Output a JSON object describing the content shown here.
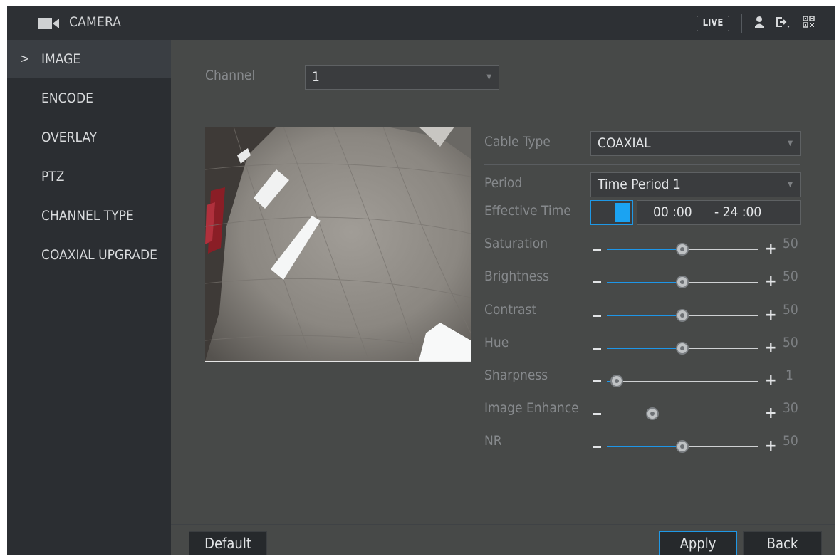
{
  "header": {
    "title": "CAMERA",
    "live_label": "LIVE",
    "icons": [
      "camera-icon",
      "user-icon",
      "logout-icon",
      "qr-code-icon"
    ]
  },
  "sidebar": {
    "items": [
      {
        "label": "IMAGE",
        "active": true
      },
      {
        "label": "ENCODE",
        "active": false
      },
      {
        "label": "OVERLAY",
        "active": false
      },
      {
        "label": "PTZ",
        "active": false
      },
      {
        "label": "CHANNEL TYPE",
        "active": false
      },
      {
        "label": "COAXIAL UPGRADE",
        "active": false
      }
    ],
    "active_marker": ">"
  },
  "channel": {
    "label": "Channel",
    "value": "1"
  },
  "settings": {
    "cable_type": {
      "label": "Cable Type",
      "value": "COAXIAL"
    },
    "period": {
      "label": "Period",
      "value": "Time Period 1"
    },
    "effective_time": {
      "label": "Effective Time",
      "enabled": true,
      "start": "00 :00",
      "end": "- 24 :00"
    }
  },
  "sliders": [
    {
      "label": "Saturation",
      "value": "50",
      "min": 0,
      "max": 100
    },
    {
      "label": "Brightness",
      "value": "50",
      "min": 0,
      "max": 100
    },
    {
      "label": "Contrast",
      "value": "50",
      "min": 0,
      "max": 100
    },
    {
      "label": "Hue",
      "value": "50",
      "min": 0,
      "max": 100
    },
    {
      "label": "Sharpness",
      "value": "1",
      "min": 0,
      "max": 15
    },
    {
      "label": "Image Enhance",
      "value": "30",
      "min": 0,
      "max": 100
    },
    {
      "label": "NR",
      "value": "50",
      "min": 0,
      "max": 100
    }
  ],
  "buttons": {
    "default": "Default",
    "apply": "Apply",
    "back": "Back"
  },
  "colors": {
    "accent": "#1ba3f2",
    "background": "#474948",
    "sidebar": "#2b2e32",
    "header": "#2d3034"
  }
}
